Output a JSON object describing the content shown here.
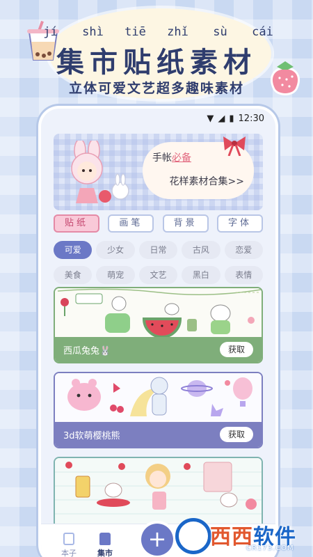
{
  "hero": {
    "pinyin": [
      "jí",
      "shì",
      "tiē",
      "zhǐ",
      "sù",
      "cái"
    ],
    "title": "集市贴纸素材",
    "subtitle": "立体可爱文艺超多趣味素材"
  },
  "status_bar": {
    "time": "12:30"
  },
  "banner": {
    "line1_prefix": "手帐",
    "line1_highlight": "必备",
    "line2": "花样素材合集>>"
  },
  "tabs": [
    {
      "label": "贴纸",
      "active": true
    },
    {
      "label": "画笔",
      "active": false
    },
    {
      "label": "背景",
      "active": false
    },
    {
      "label": "字体",
      "active": false
    }
  ],
  "chips": [
    {
      "label": "可爱",
      "active": true
    },
    {
      "label": "少女",
      "active": false
    },
    {
      "label": "日常",
      "active": false
    },
    {
      "label": "古风",
      "active": false
    },
    {
      "label": "恋爱",
      "active": false
    },
    {
      "label": "美食",
      "active": false
    },
    {
      "label": "萌宠",
      "active": false
    },
    {
      "label": "文艺",
      "active": false
    },
    {
      "label": "黑白",
      "active": false
    },
    {
      "label": "表情",
      "active": false
    }
  ],
  "cards": [
    {
      "name": "西瓜兔兔🐰",
      "button": "获取",
      "color": "#7fae7a"
    },
    {
      "name": "3d软萌樱桃熊",
      "button": "获取",
      "color": "#7c7fc0"
    },
    {
      "name": "",
      "button": "",
      "color": "#7fb4b0"
    }
  ],
  "bottom_nav": {
    "book_label": "本子",
    "market_label": "集市",
    "add_symbol": "+"
  },
  "watermark": {
    "brand_a": "西西",
    "brand_b": "软件园",
    "url": "CR173.COM"
  },
  "colors": {
    "accent": "#6b78c6",
    "title_navy": "#2f3d6e",
    "tab_active": "#f9c9d8"
  }
}
